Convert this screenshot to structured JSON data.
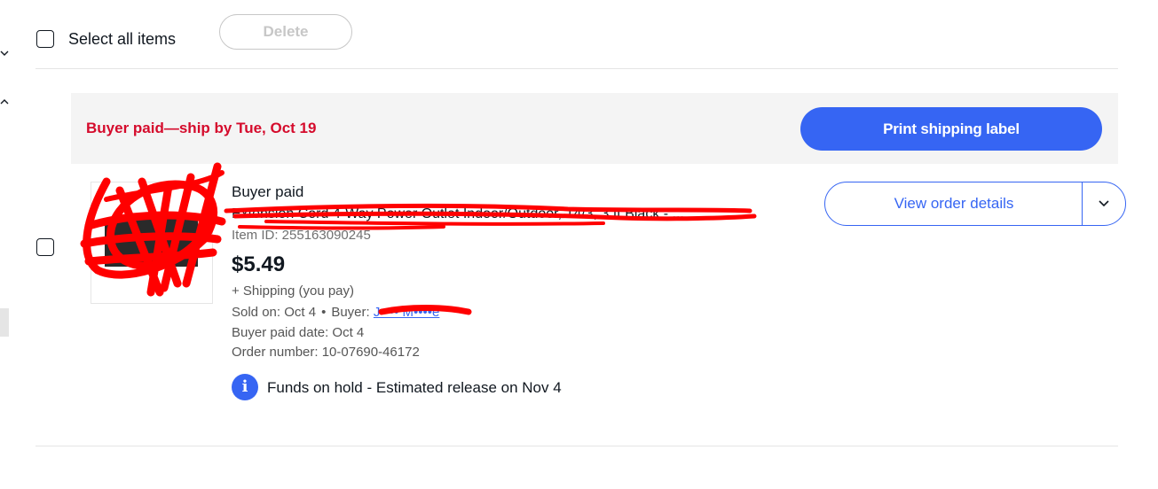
{
  "toolbar": {
    "select_all_label": "Select all items",
    "delete_label": "Delete"
  },
  "sidebar": {
    "expand_icon": "chevron-down-icon",
    "collapse_icon": "chevron-up-icon"
  },
  "order": {
    "status_banner": "Buyer paid—ship by Tue, Oct 19",
    "print_label": "Print shipping label",
    "status": "Buyer paid",
    "title": "Extension Cord 4-Way Power Outlet Indoor/Outdoor, 14/3, 3 ft Black - ...",
    "item_id": "Item ID: 255163090245",
    "price": "$5.49",
    "shipping": "+ Shipping (you pay)",
    "sold_on": "Sold on: Oct 4",
    "buyer_label": "Buyer:",
    "buyer_name": "J•••• M••••e",
    "paid_date": "Buyer paid date: Oct 4",
    "order_number": "Order number: 10-07690-46172",
    "funds_note": "Funds on hold - Estimated release on Nov 4",
    "view_details_label": "View order details",
    "info_icon": "info-icon"
  },
  "colors": {
    "accent": "#3665f3",
    "alert": "#d50b2c",
    "banner_bg": "#f4f4f4",
    "redaction": "#ff0000"
  }
}
